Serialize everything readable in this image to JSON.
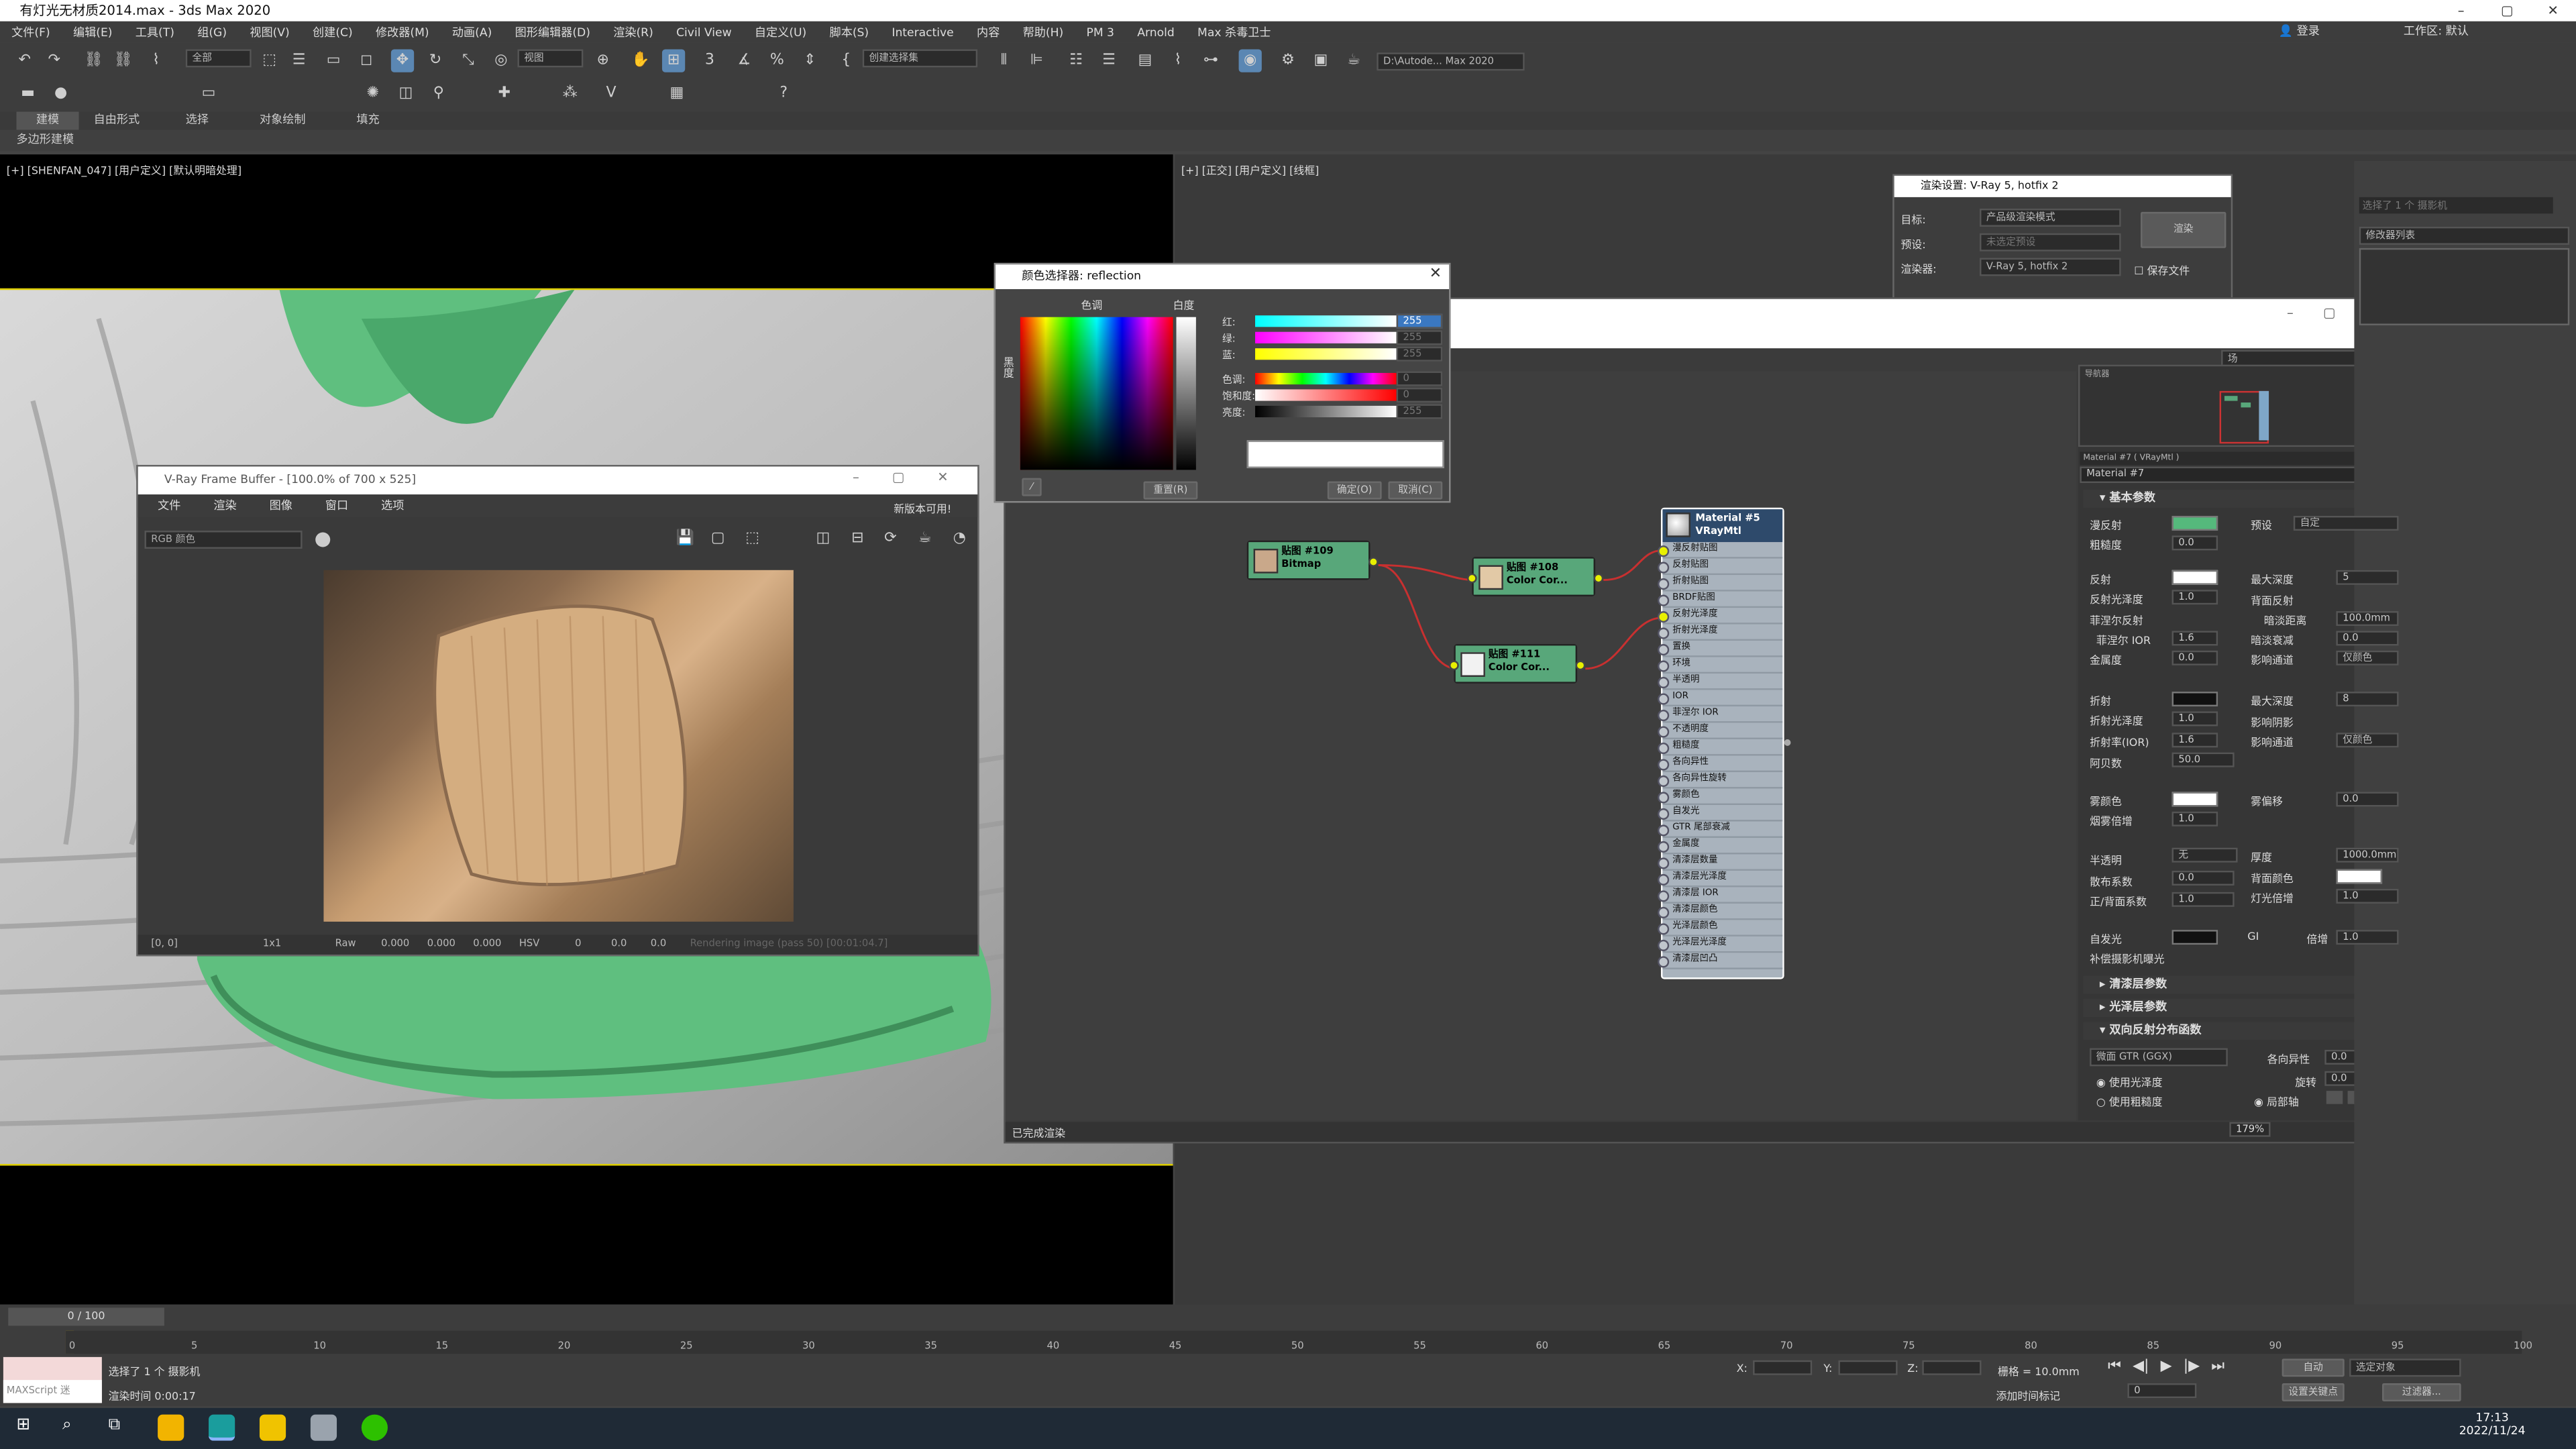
{
  "titlebar": {
    "title": "有灯光无材质2014.max - 3ds Max 2020",
    "min": "–",
    "max": "▢",
    "close": "✕"
  },
  "menu": [
    "文件(F)",
    "编辑(E)",
    "工具(T)",
    "组(G)",
    "视图(V)",
    "创建(C)",
    "修改器(M)",
    "动画(A)",
    "图形编辑器(D)",
    "渲染(R)",
    "Civil View",
    "自定义(U)",
    "脚本(S)",
    "Interactive",
    "内容",
    "帮助(H)",
    "PM 3",
    "Arnold",
    "Max 杀毒卫士"
  ],
  "user": {
    "login": "登录",
    "workspace_label": "工作区:",
    "workspace_value": "默认"
  },
  "toolbar": {
    "filter_all": "全部",
    "view_dd": "视图",
    "selection_set": "创建选择集",
    "project_path": "D:\\Autode... Max 2020"
  },
  "ribbon": {
    "tabs": [
      "建模",
      "自由形式",
      "选择",
      "对象绘制",
      "填充"
    ],
    "subtitle": "多边形建模"
  },
  "viewport_left": {
    "label": "[+] [SHENFAN_047] [用户定义] [默认明暗处理]"
  },
  "viewport_right": {
    "label": "[+] [正交] [用户定义] [线框]"
  },
  "vfb": {
    "title": "V-Ray Frame Buffer - [100.0% of 700 x 525]",
    "menu": [
      "文件",
      "渲染",
      "图像",
      "窗口",
      "选项"
    ],
    "update": "新版本可用!",
    "channel": "RGB 颜色",
    "status": {
      "coord": "[0, 0]",
      "zoom": "1x1",
      "raw": "Raw",
      "v1": "0.000",
      "v2": "0.000",
      "v3": "0.000",
      "mode": "HSV",
      "h": "0",
      "s": "0.0",
      "v": "0.0",
      "msg": "Rendering image (pass 50) [00:01:04.7]"
    }
  },
  "colorpicker": {
    "title": "颜色选择器: reflection",
    "hue_label": "色调",
    "white_label": "白度",
    "black_label": "黑度",
    "rows": [
      {
        "label": "红:",
        "value": "255"
      },
      {
        "label": "绿:",
        "value": "255"
      },
      {
        "label": "蓝:",
        "value": "255"
      },
      {
        "label": "色调:",
        "value": "0"
      },
      {
        "label": "饱和度:",
        "value": "0"
      },
      {
        "label": "亮度:",
        "value": "255"
      }
    ],
    "reset": "重置(R)",
    "ok": "确定(O)",
    "cancel": "取消(C)"
  },
  "render_setup": {
    "title": "渲染设置: V-Ray 5, hotfix 2",
    "target_label": "目标:",
    "target_value": "产品级渲染模式",
    "preset_label": "预设:",
    "preset_value": "未选定预设",
    "renderer_label": "渲染器:",
    "renderer_value": "V-Ray 5, hotfix 2",
    "save_file": "保存文件",
    "render_btn": "渲染"
  },
  "slate": {
    "search_value": "场",
    "status": "已完成渲染",
    "zoom": "179%",
    "nav_label": "导航器",
    "nodes": {
      "bitmap": {
        "name": "贴图 #109",
        "type": "Bitmap"
      },
      "cc1": {
        "name": "贴图 #108",
        "type": "Color Cor..."
      },
      "cc2": {
        "name": "贴图 #111",
        "type": "Color Cor..."
      },
      "mtl": {
        "name": "Material #5",
        "type": "VRayMtl"
      }
    },
    "slots": [
      "漫反射贴图",
      "反射贴图",
      "折射贴图",
      "BRDF贴图",
      "反射光泽度",
      "折射光泽度",
      "置换",
      "环境",
      "半透明",
      "IOR",
      "菲涅尔 IOR",
      "不透明度",
      "粗糙度",
      "各向异性",
      "各向异性旋转",
      "雾颜色",
      "自发光",
      "GTR 尾部衰减",
      "金属度",
      "清漆层数量",
      "清漆层光泽度",
      "清漆层 IOR",
      "清漆层颜色",
      "光泽层颜色",
      "光泽层光泽度",
      "清漆层凹凸"
    ]
  },
  "props": {
    "header": "Material #7 ( VRayMtl )",
    "name": "Material #7",
    "basic": "基本参数",
    "diffuse": "漫反射",
    "preset": "预设",
    "preset_value": "自定",
    "roughness": "粗糙度",
    "roughness_v": "0.0",
    "reflect": "反射",
    "max_depth": "最大深度",
    "max_depth_v": "5",
    "refl_gloss": "反射光泽度",
    "refl_gloss_v": "1.0",
    "back_reflect": "背面反射",
    "fresnel": "菲涅尔反射",
    "dim_dist": "暗淡距离",
    "dim_dist_v": "100.0mm",
    "fresnel_ior": "菲涅尔 IOR",
    "fresnel_ior_v": "1.6",
    "dim_falloff": "暗淡衰减",
    "dim_falloff_v": "0.0",
    "metalness": "金属度",
    "metalness_v": "0.0",
    "affect_ch": "影响通道",
    "affect_ch_v": "仅颜色",
    "refract": "折射",
    "max_depth2_v": "8",
    "refr_gloss": "折射光泽度",
    "refr_gloss_v": "1.0",
    "affect_shadow": "影响阴影",
    "ior": "折射率(IOR)",
    "ior_v": "1.6",
    "affect_ch2": "影响通道",
    "affect_ch2_v": "仅颜色",
    "abbe": "阿贝数",
    "abbe_v": "50.0",
    "fog": "雾颜色",
    "fog_bias": "雾偏移",
    "fog_bias_v": "0.0",
    "fog_mult": "烟雾倍增",
    "fog_mult_v": "1.0",
    "translucency": "半透明",
    "translucency_v": "无",
    "thickness": "厚度",
    "thickness_v": "1000.0mm",
    "scatter": "散布系数",
    "scatter_v": "0.0",
    "back_color": "背面颜色",
    "fwd_back": "正/背面系数",
    "fwd_back_v": "1.0",
    "light_mult": "灯光倍增",
    "light_mult_v": "1.0",
    "self_illum": "自发光",
    "gi": "GI",
    "mult": "倍增",
    "mult_v": "1.0",
    "comp_exposure": "补偿摄影机曝光",
    "sec_clearcoat": "清漆层参数",
    "sec_sheen": "光泽层参数",
    "sec_brdf": "双向反射分布函数",
    "brdf_type": "微面 GTR (GGX)",
    "anisotropy": "各向异性",
    "anisotropy_v": "0.0",
    "rotation": "旋转",
    "rotation_v": "0.0",
    "use_gloss": "使用光泽度",
    "use_rough": "使用粗糙度",
    "local_axis": "局部轴",
    "colors": {
      "diffuse": "#55b97c",
      "reflect": "#ffffff",
      "refract": "#111111",
      "fog": "#ffffff",
      "back": "#ffffff",
      "self_illum": "#111111"
    }
  },
  "cmdpanel": {
    "selected": "选择了 1 个 摄影机",
    "modifier_list": "修改器列表"
  },
  "timeline": {
    "frame": "0 / 100",
    "ticks": [
      "0",
      "5",
      "10",
      "15",
      "20",
      "25",
      "30",
      "35",
      "40",
      "45",
      "50",
      "55",
      "60",
      "65",
      "70",
      "75",
      "80",
      "85",
      "90",
      "95",
      "100"
    ]
  },
  "status": {
    "maxscript": "MAXScript 迷",
    "selected": "选择了 1 个 摄影机",
    "render_time_label": "渲染时间",
    "render_time": "0:00:17",
    "x": "X:",
    "y": "Y:",
    "z": "Z:",
    "grid": "栅格 = 10.0mm",
    "add_tag": "添加时间标记",
    "auto": "自动",
    "set_key": "设置关键点",
    "sel_obj": "选定对象",
    "filter": "过滤器...",
    "frame_spin": "0"
  },
  "taskbar": {
    "time": "17:13",
    "date": "2022/11/24"
  }
}
